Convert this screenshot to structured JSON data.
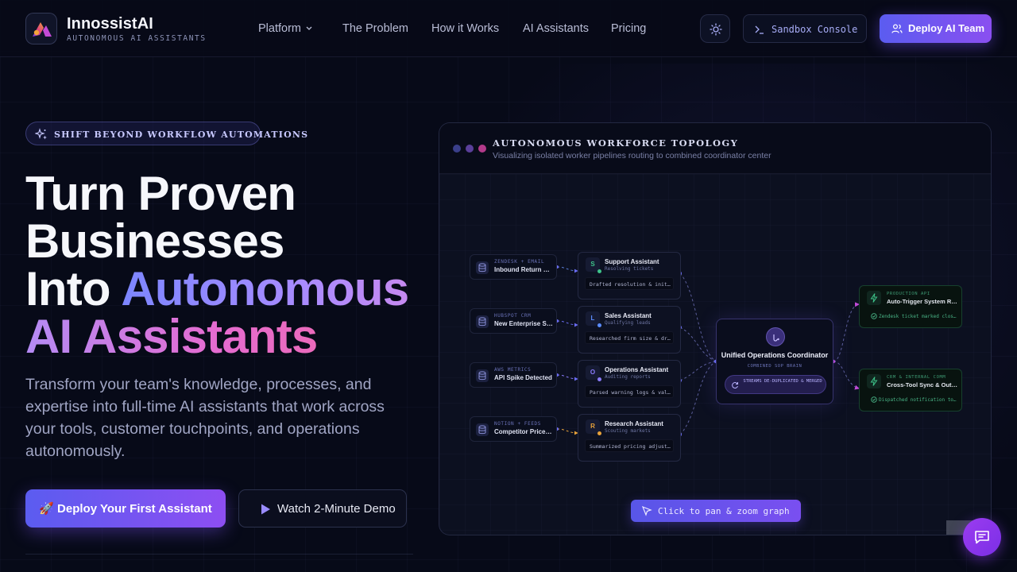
{
  "brand": {
    "name": "InnossistAI",
    "tagline": "AUTONOMOUS AI ASSISTANTS"
  },
  "nav": {
    "links": [
      "Platform",
      "The Problem",
      "How it Works",
      "AI Assistants",
      "Pricing"
    ],
    "sandbox_label": "Sandbox Console",
    "deploy_label": "Deploy AI Team"
  },
  "hero": {
    "badge": "SHIFT BEYOND WORKFLOW AUTOMATIONS",
    "title_line1": "Turn Proven",
    "title_line2": "Businesses",
    "title_line3_plain": "Into ",
    "title_line3_accent": "Autonomous",
    "title_line4": "AI Assistants",
    "subtitle": "Transform your team's knowledge, processes, and expertise into full-time AI assistants that work across your tools, customer touchpoints, and operations autonomously.",
    "cta_primary": "🚀 Deploy Your First Assistant",
    "cta_secondary": "Watch 2-Minute Demo"
  },
  "topology": {
    "title": "AUTONOMOUS WORKFORCE TOPOLOGY",
    "subtitle": "Visualizing isolated worker pipelines routing to combined coordinator center",
    "sources": [
      {
        "kind": "ZENDESK + EMAIL",
        "title": "Inbound Return Request"
      },
      {
        "kind": "HUBSPOT CRM",
        "title": "New Enterprise Signup"
      },
      {
        "kind": "AWS METRICS",
        "title": "API Spike Detected"
      },
      {
        "kind": "NOTION + FEEDS",
        "title": "Competitor Price Change"
      }
    ],
    "agents": [
      {
        "letter": "S",
        "name": "Support Assistant",
        "status": "Resolving tickets",
        "log": "Drafted resolution & initiated refund",
        "color": "#3ec48a"
      },
      {
        "letter": "L",
        "name": "Sales Assistant",
        "status": "Qualifying leads",
        "log": "Researched firm size & drafted outreach",
        "color": "#5b8cff"
      },
      {
        "letter": "O",
        "name": "Operations Assistant",
        "status": "Auditing reports",
        "log": "Parsed warning logs & validated fix",
        "color": "#8b7cff"
      },
      {
        "letter": "R",
        "name": "Research Assistant",
        "status": "Scouting markets",
        "log": "Summarized pricing adjustments",
        "color": "#e8a23a"
      }
    ],
    "coordinator": {
      "name": "Unified Operations Coordinator",
      "tag": "COMBINED SOP BRAIN",
      "stream": "STREAMS DE-DUPLICATED & MERGED"
    },
    "outputs": [
      {
        "kind": "PRODUCTION API",
        "title": "Auto-Trigger System Refund",
        "status": "Zendesk ticket marked closed"
      },
      {
        "kind": "CRM & INTERNAL COMM",
        "title": "Cross-Tool Sync & Outreach",
        "status": "Dispatched notification to Slack"
      }
    ],
    "pan_hint": "Click to pan & zoom graph"
  },
  "colors": {
    "accent": "#6a5cf2",
    "accent_2": "#8d4ef2",
    "success": "#3ec48a"
  }
}
